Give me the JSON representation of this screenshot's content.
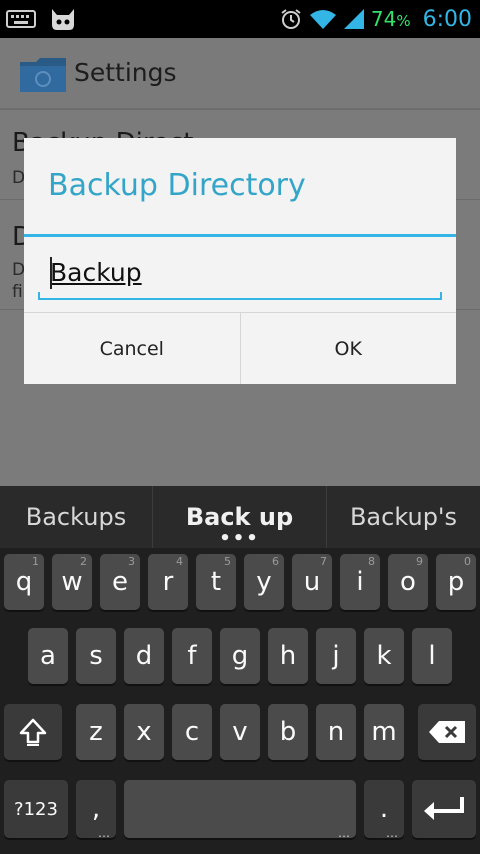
{
  "status_bar": {
    "battery": "74",
    "battery_unit": "%",
    "time": "6:00"
  },
  "background_app": {
    "title": "Settings",
    "items": [
      {
        "title": "Backup Direct",
        "subtitle": "D"
      },
      {
        "title": "D",
        "subtitle": "D",
        "subtitle2": "fi"
      }
    ]
  },
  "dialog": {
    "title": "Backup Directory",
    "input_value": "Backup",
    "cancel_label": "Cancel",
    "ok_label": "OK"
  },
  "keyboard": {
    "suggestions": [
      "Backups",
      "Back up",
      "Backup's"
    ],
    "row1": [
      "q",
      "w",
      "e",
      "r",
      "t",
      "y",
      "u",
      "i",
      "o",
      "p"
    ],
    "row1_hints": [
      "1",
      "2",
      "3",
      "4",
      "5",
      "6",
      "7",
      "8",
      "9",
      "0"
    ],
    "row2": [
      "a",
      "s",
      "d",
      "f",
      "g",
      "h",
      "j",
      "k",
      "l"
    ],
    "row3": [
      "z",
      "x",
      "c",
      "v",
      "b",
      "n",
      "m"
    ],
    "symbols_label": "?123",
    "comma_label": ",",
    "period_label": "."
  },
  "colors": {
    "accent": "#33b5e5",
    "battery": "#33e26d"
  }
}
